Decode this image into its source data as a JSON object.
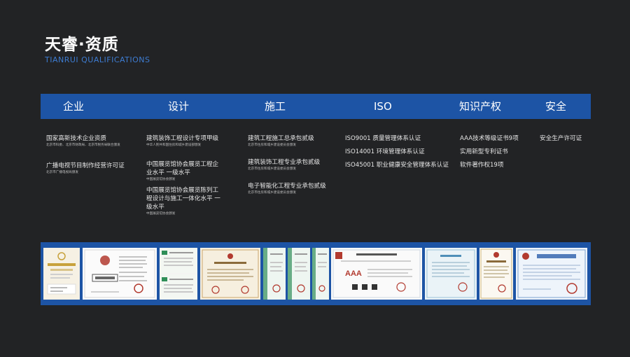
{
  "header": {
    "title": "天睿·资质",
    "subtitle": "TIANRUI QUALIFICATIONS"
  },
  "categories": [
    "企业",
    "设计",
    "施工",
    "ISO",
    "知识产权",
    "安全"
  ],
  "columns": [
    {
      "items": [
        {
          "name": "国家高新技术企业资质",
          "issuer": "北京市科委、北京市财政局、北京市税务局联合颁发"
        },
        {
          "name": "广播电视节目制作经营许可证",
          "issuer": "北京市广播电视局颁发"
        }
      ]
    },
    {
      "items": [
        {
          "name": "建筑装饰工程设计专项甲级",
          "issuer": "中华人民共和国住房和城乡建设部颁发"
        },
        {
          "name": "中国展览馆协会展览工程企业水平  一级水平",
          "issuer": "中国展览馆协会颁发"
        },
        {
          "name": "中国展览馆协会展览陈列工程设计与施工一体化水平  一级水平",
          "issuer": "中国展览馆协会颁发"
        }
      ]
    },
    {
      "items": [
        {
          "name": "建筑工程施工总承包贰级",
          "issuer": "北京市住房和城乡建设委员会颁发"
        },
        {
          "name": "建筑装饰工程专业承包贰级",
          "issuer": "北京市住房和城乡建设委员会颁发"
        },
        {
          "name": "电子智能化工程专业承包贰级",
          "issuer": "北京市住房和城乡建设委员会颁发"
        }
      ]
    },
    {
      "items": [
        {
          "name": "ISO9001  质量管理体系认证"
        },
        {
          "name": "ISO14001 环境管理体系认证"
        },
        {
          "name": "ISO45001 职业健康安全管理体系认证"
        }
      ]
    },
    {
      "items": [
        {
          "name": "AAA技术等级证书9项"
        },
        {
          "name": "实用新型专利证书"
        },
        {
          "name": "软件著作权19项"
        }
      ]
    },
    {
      "items": [
        {
          "name": "安全生产许可证"
        }
      ]
    }
  ],
  "certificates": [
    {
      "name": "certificate-high-tech",
      "accent": "#c8a23c"
    },
    {
      "name": "certificate-qualification",
      "accent": "#b23a2f"
    },
    {
      "name": "certificate-design-a",
      "accent": "#2f8f58"
    },
    {
      "name": "certificate-construction",
      "accent": "#b23a2f"
    },
    {
      "name": "certificate-iso-9001",
      "accent": "#2f8f58"
    },
    {
      "name": "certificate-iso-14001",
      "accent": "#2f8f58"
    },
    {
      "name": "certificate-iso-45001",
      "accent": "#2f8f58"
    },
    {
      "name": "certificate-aaa",
      "accent": "#b23a2f"
    },
    {
      "name": "certificate-patent",
      "accent": "#4f8fb8"
    },
    {
      "name": "certificate-software",
      "accent": "#b23a2f"
    },
    {
      "name": "certificate-safety",
      "accent": "#b23a2f"
    }
  ]
}
